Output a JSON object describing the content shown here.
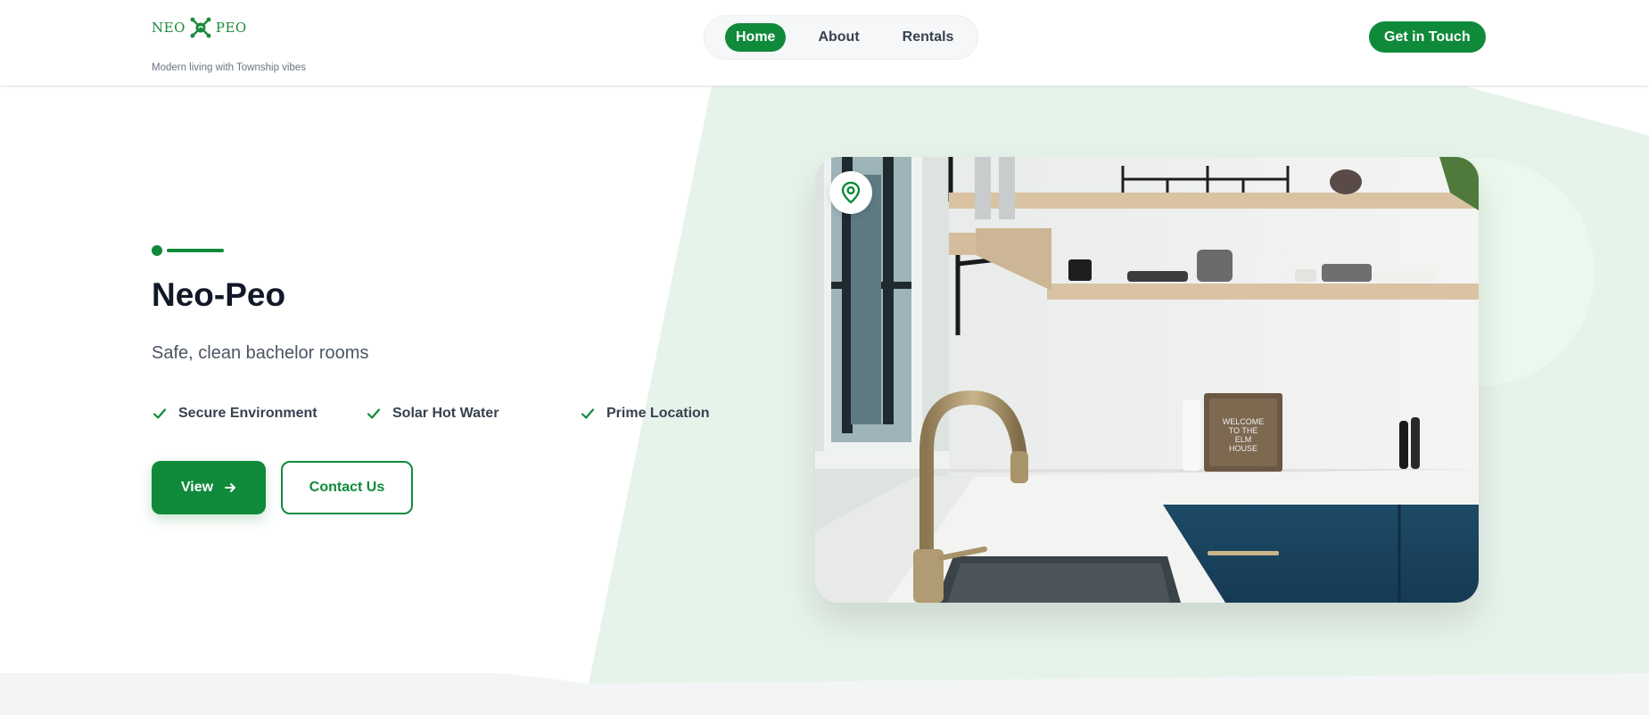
{
  "brand": {
    "logo_text_left": "NEO",
    "logo_text_right": "PEO",
    "tagline": "Modern living with Township vibes",
    "color": "#0f8a3a"
  },
  "nav": {
    "items": [
      {
        "label": "Home",
        "active": true
      },
      {
        "label": "About",
        "active": false
      },
      {
        "label": "Rentals",
        "active": false
      }
    ]
  },
  "header": {
    "cta_label": "Get in Touch"
  },
  "hero": {
    "title": "Neo-Peo",
    "subtitle": "Safe, clean bachelor rooms",
    "features": [
      {
        "label": "Secure Environment",
        "icon": "check-icon"
      },
      {
        "label": "Solar Hot Water",
        "icon": "check-icon"
      },
      {
        "label": "Prime Location",
        "icon": "check-icon"
      }
    ],
    "primary_button": {
      "label": "View",
      "icon": "arrow-right-icon"
    },
    "secondary_button": {
      "label": "Contact Us"
    },
    "image": {
      "subject": "kitchen with brass faucet, open wooden shelves and navy cabinets",
      "sign_text": "WELCOME TO THE ELM HOUSE",
      "badge_icon": "map-pin-icon"
    }
  },
  "colors": {
    "accent": "#0f8a3a",
    "accent_light": "#e5f3e9",
    "text_dark": "#111827",
    "text_muted": "#4b5563"
  }
}
